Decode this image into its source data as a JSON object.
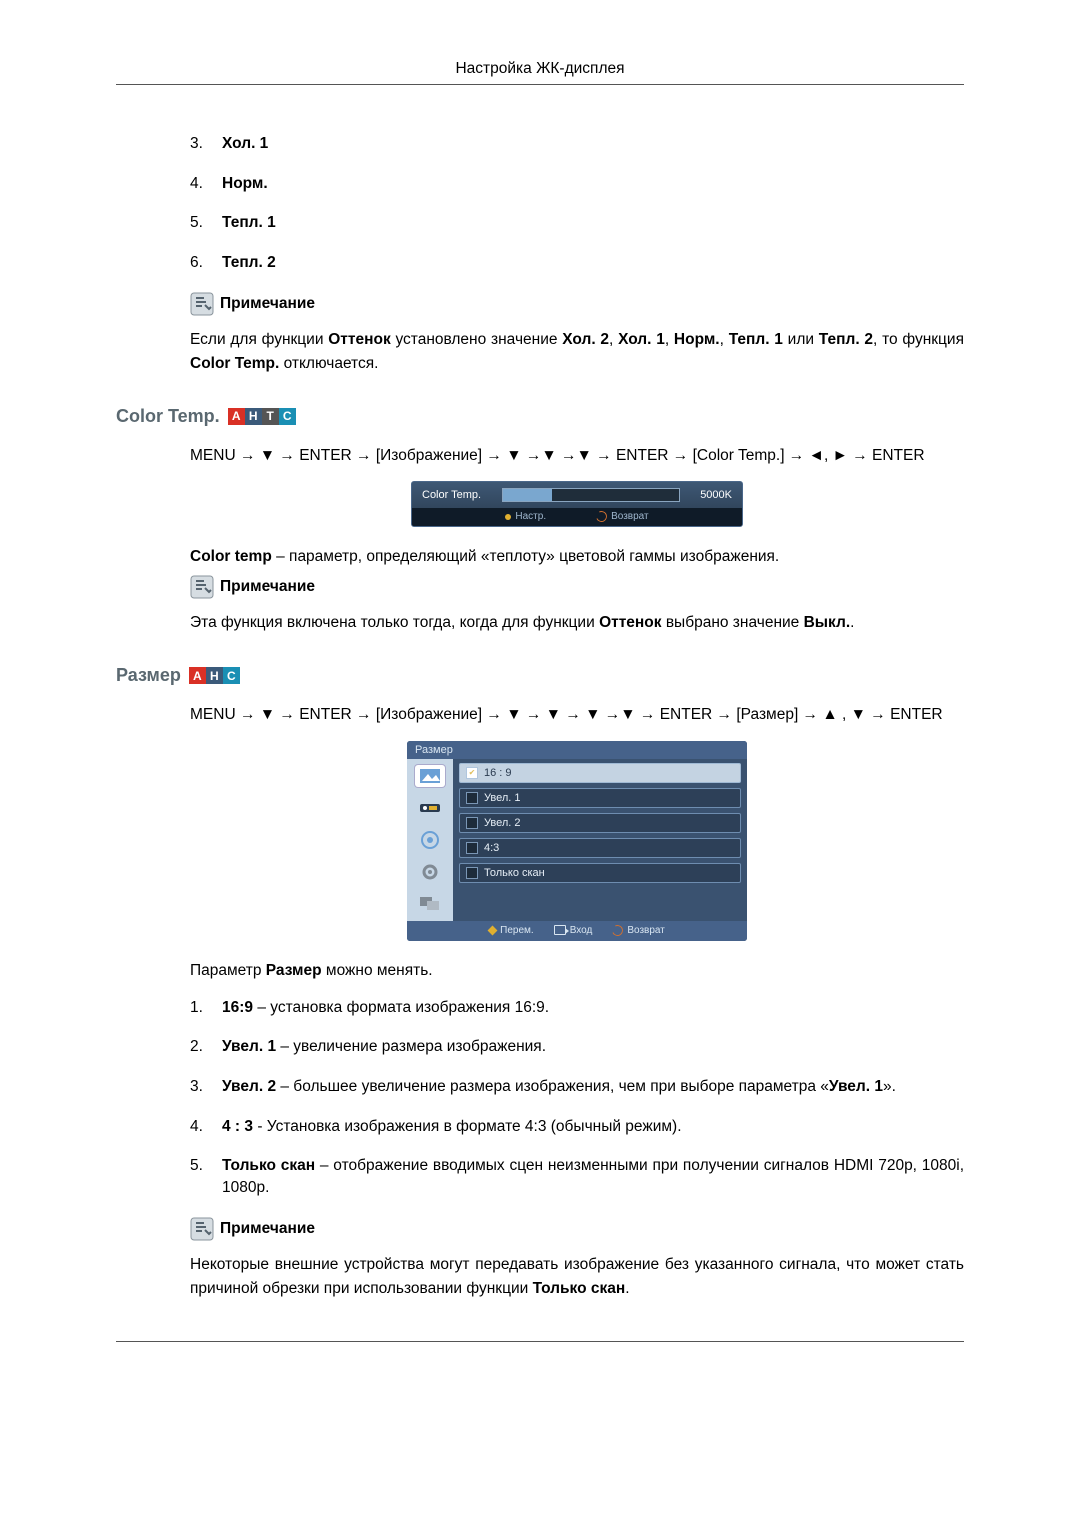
{
  "header": {
    "title": "Настройка ЖК-дисплея"
  },
  "topList": [
    {
      "num": "3.",
      "bold": "Хол. 1"
    },
    {
      "num": "4.",
      "bold": "Норм."
    },
    {
      "num": "5.",
      "bold": "Тепл. 1"
    },
    {
      "num": "6.",
      "bold": "Тепл. 2"
    }
  ],
  "note_label": "Примечание",
  "note1": {
    "t1": "Если для функции ",
    "b1": "Оттенок",
    "t2": " установлено значение ",
    "b2": "Хол. 2",
    "comma1": ", ",
    "b3": "Хол. 1",
    "comma2": ", ",
    "b4": "Норм.",
    "comma3": ", ",
    "b5": "Тепл. 1",
    "t3": " или ",
    "b6": "Тепл. 2",
    "t4": ", то функция ",
    "b7": "Color Temp.",
    "t5": " отключается."
  },
  "section_colortemp": {
    "title": "Color Temp.",
    "badges": [
      "A",
      "H",
      "T",
      "C"
    ]
  },
  "path_colortemp": "MENU → ▼ → ENTER → [Изображение] → ▼ →▼ →▼ → ENTER → [Color Temp.] → ◄, ► → ENTER",
  "osd_slider": {
    "label": "Color Temp.",
    "value": "5000K",
    "footer_left": "Настр.",
    "footer_right": "Возврат"
  },
  "colortemp_desc": {
    "b1": "Color temp",
    "t1": " – параметр, определяющий «теплоту» цветовой гаммы изображения."
  },
  "note2": {
    "t1": "Эта функция включена только тогда, когда для функции ",
    "b1": "Оттенок",
    "t2": " выбрано значение ",
    "b2": "Выкл.",
    "t3": "."
  },
  "section_size": {
    "title": "Размер",
    "badges": [
      "A",
      "H",
      "C"
    ]
  },
  "path_size": "MENU → ▼ → ENTER → [Изображение] → ▼ → ▼ → ▼ →▼ → ENTER → [Размер] → ▲ , ▼ → ENTER",
  "osd_menu": {
    "title": "Размер",
    "options": [
      {
        "label": "16 : 9",
        "selected": true
      },
      {
        "label": "Увел. 1",
        "selected": false
      },
      {
        "label": "Увел. 2",
        "selected": false
      },
      {
        "label": "4:3",
        "selected": false
      },
      {
        "label": "Только скан",
        "selected": false
      }
    ],
    "footer": {
      "move": "Перем.",
      "enter": "Вход",
      "return": "Возврат"
    }
  },
  "size_intro": {
    "t1": "Параметр ",
    "b1": "Размер",
    "t2": " можно менять."
  },
  "sizeList": [
    {
      "num": "1.",
      "b": "16:9",
      "t": " – установка формата изображения 16:9."
    },
    {
      "num": "2.",
      "b": "Увел. 1",
      "t": " – увеличение размера изображения."
    },
    {
      "num": "3.",
      "b": "Увел. 2",
      "t": " – большее увеличение размера изображения, чем при выборе параметра «",
      "b2": "Увел. 1",
      "t2": "»."
    },
    {
      "num": "4.",
      "b": "4 : 3",
      "t": " - Установка изображения в формате 4:3 (обычный режим)."
    },
    {
      "num": "5.",
      "b": "Только скан",
      "t": " – отображение вводимых сцен неизменными при получении сигналов HDMI 720p, 1080i, 1080p."
    }
  ],
  "note3": {
    "t1": "Некоторые внешние устройства могут передавать изображение без указанного сигнала, что может стать причиной обрезки при использовании функции ",
    "b1": "Только скан",
    "t2": "."
  }
}
